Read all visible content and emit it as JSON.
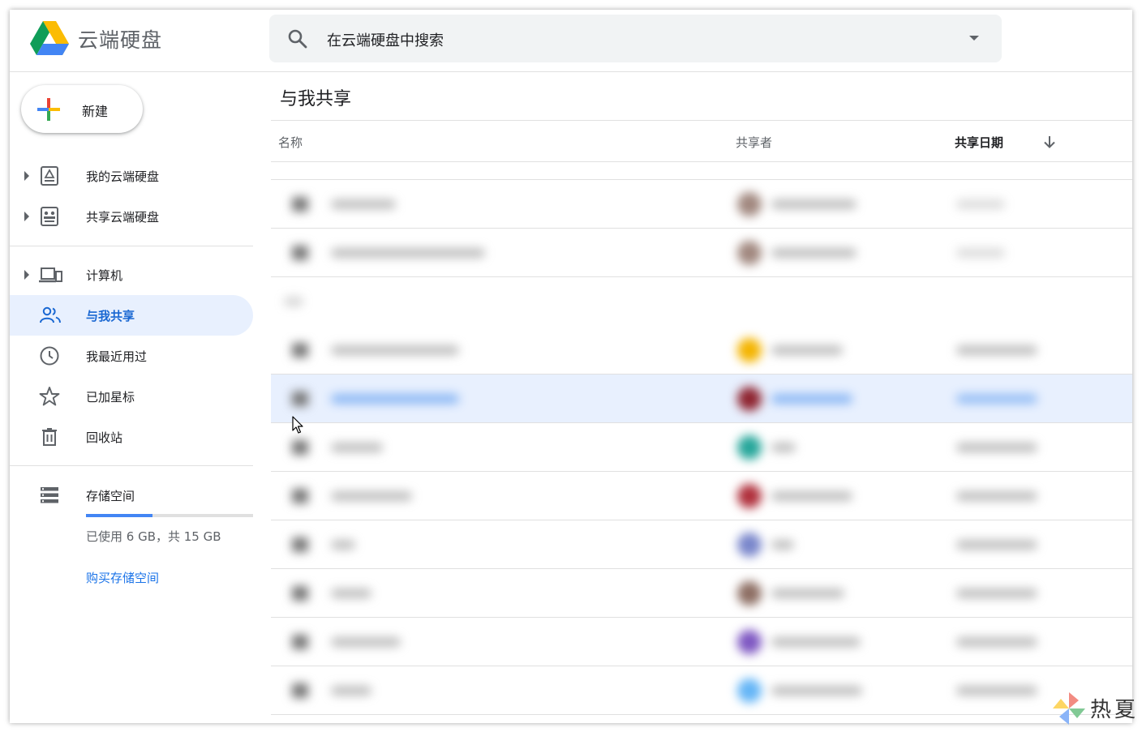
{
  "app": {
    "title": "云端硬盘"
  },
  "search": {
    "placeholder": "在云端硬盘中搜索"
  },
  "sidebar": {
    "new_label": "新建",
    "items": [
      {
        "label": "我的云端硬盘",
        "icon": "drive-icon",
        "expandable": true
      },
      {
        "label": "共享云端硬盘",
        "icon": "shared-drive-icon",
        "expandable": true
      },
      {
        "label": "计算机",
        "icon": "computer-icon",
        "expandable": true
      },
      {
        "label": "与我共享",
        "icon": "people-icon",
        "active": true
      },
      {
        "label": "我最近用过",
        "icon": "clock-icon"
      },
      {
        "label": "已加星标",
        "icon": "star-icon"
      },
      {
        "label": "回收站",
        "icon": "trash-icon"
      }
    ],
    "storage": {
      "label": "存储空间",
      "icon": "storage-icon",
      "used_text": "已使用 6 GB，共 15 GB",
      "used_fraction": 0.4,
      "buy_label": "购买存储空间"
    }
  },
  "main": {
    "title": "与我共享",
    "columns": {
      "name": "名称",
      "shared_by": "共享者",
      "share_date": "共享日期"
    },
    "sort": "descending"
  },
  "colors": {
    "accent": "#1a73e8",
    "active_bg": "#e8f0fe",
    "avatars": [
      "#a1887f",
      "#a1887f",
      "#f4b400",
      "#8e2430",
      "#26a69a",
      "#b0303c",
      "#7986cb",
      "#8d6e63",
      "#7e57c2",
      "#64b5f6"
    ]
  },
  "watermark": {
    "text": "热夏"
  }
}
